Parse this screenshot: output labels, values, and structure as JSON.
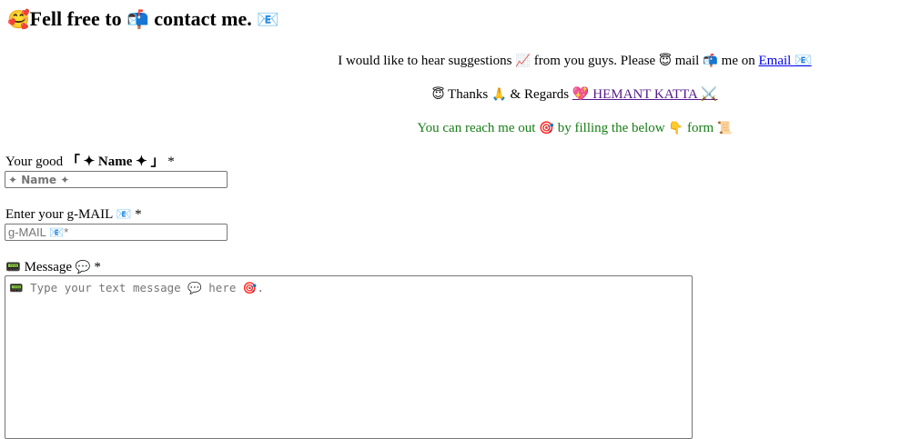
{
  "header": {
    "emoji_start": "🥰",
    "title_part1": "Fell free to ",
    "emoji_mailbox": "📬",
    "title_part2": " contact me. ",
    "emoji_envelope": "📧"
  },
  "intro": {
    "text1": "I would like to hear suggestions ",
    "emoji_chart": "📈",
    "text2": " from you guys. Please ",
    "emoji_angel": "😇",
    "text3": " mail ",
    "emoji_mailbox": "📬",
    "text4": " me on ",
    "email_link": "Email 📧"
  },
  "thanks": {
    "emoji_angel": "😇",
    "text1": " Thanks ",
    "emoji_pray": "🙏",
    "text2": " & Regards ",
    "name_link": "💖 HEMANT KATTA ⚔️"
  },
  "reach": {
    "text1": "You can reach me out ",
    "emoji_target": "🎯",
    "text2": " by filling the below ",
    "emoji_point": "👇",
    "text3": " form ",
    "emoji_scroll": "📜"
  },
  "form": {
    "name_label_prefix": "Your good ",
    "name_label_strong": "「 ✦ Name ✦ 」",
    "name_required": " *",
    "name_placeholder": "✦ Name ✦",
    "email_label": "Enter your g-MAIL ",
    "email_label_emoji": "📧",
    "email_required": " *",
    "email_placeholder": "g-MAIL 📧*",
    "message_emoji": "📟",
    "message_label": " Message ",
    "message_bubble": "💬",
    "message_required": " *",
    "message_placeholder": "📟 Type your text message 💬 here 🎯."
  }
}
